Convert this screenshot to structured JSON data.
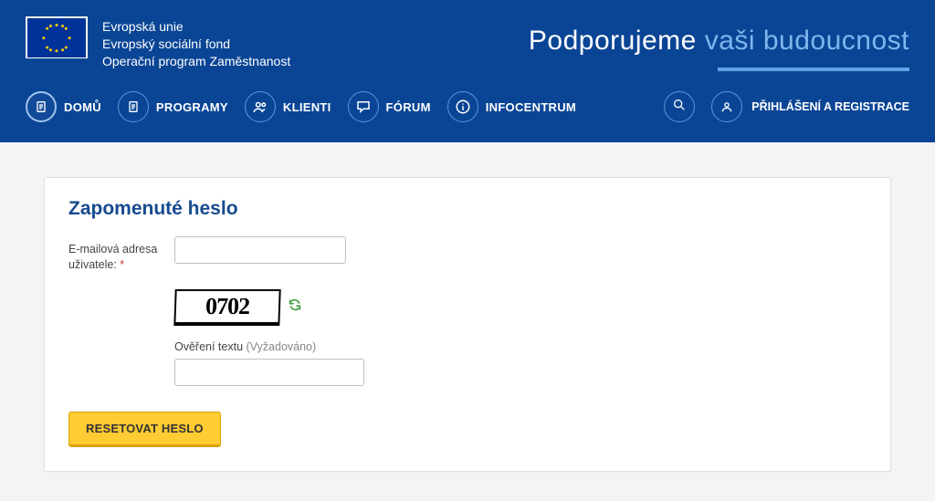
{
  "header": {
    "eu_lines": [
      "Evropská unie",
      "Evropský sociální fond",
      "Operační program Zaměstnanost"
    ],
    "slogan_part1": "Podporujeme ",
    "slogan_part2": "vaši budoucnost"
  },
  "nav": {
    "items": [
      {
        "label": "DOMŮ",
        "icon": "document-icon",
        "active": true
      },
      {
        "label": "PROGRAMY",
        "icon": "document-icon",
        "active": false
      },
      {
        "label": "KLIENTI",
        "icon": "users-icon",
        "active": false
      },
      {
        "label": "FÓRUM",
        "icon": "chat-icon",
        "active": false
      },
      {
        "label": "INFOCENTRUM",
        "icon": "info-icon",
        "active": false
      }
    ],
    "auth_label": "PŘIHLÁŠENÍ A REGISTRACE"
  },
  "form": {
    "title": "Zapomenuté heslo",
    "email_label": "E-mailová adresa uživatele:",
    "required_mark": "*",
    "email_value": "",
    "captcha_text": "0702",
    "captcha_label_prefix": "Ověření textu ",
    "captcha_label_hint": "(Vyžadováno)",
    "captcha_value": "",
    "submit_label": "RESETOVAT HESLO"
  },
  "colors": {
    "banner_bg": "#0a4595",
    "accent_light": "#7fb6ef",
    "button_bg": "#ffcc33"
  }
}
